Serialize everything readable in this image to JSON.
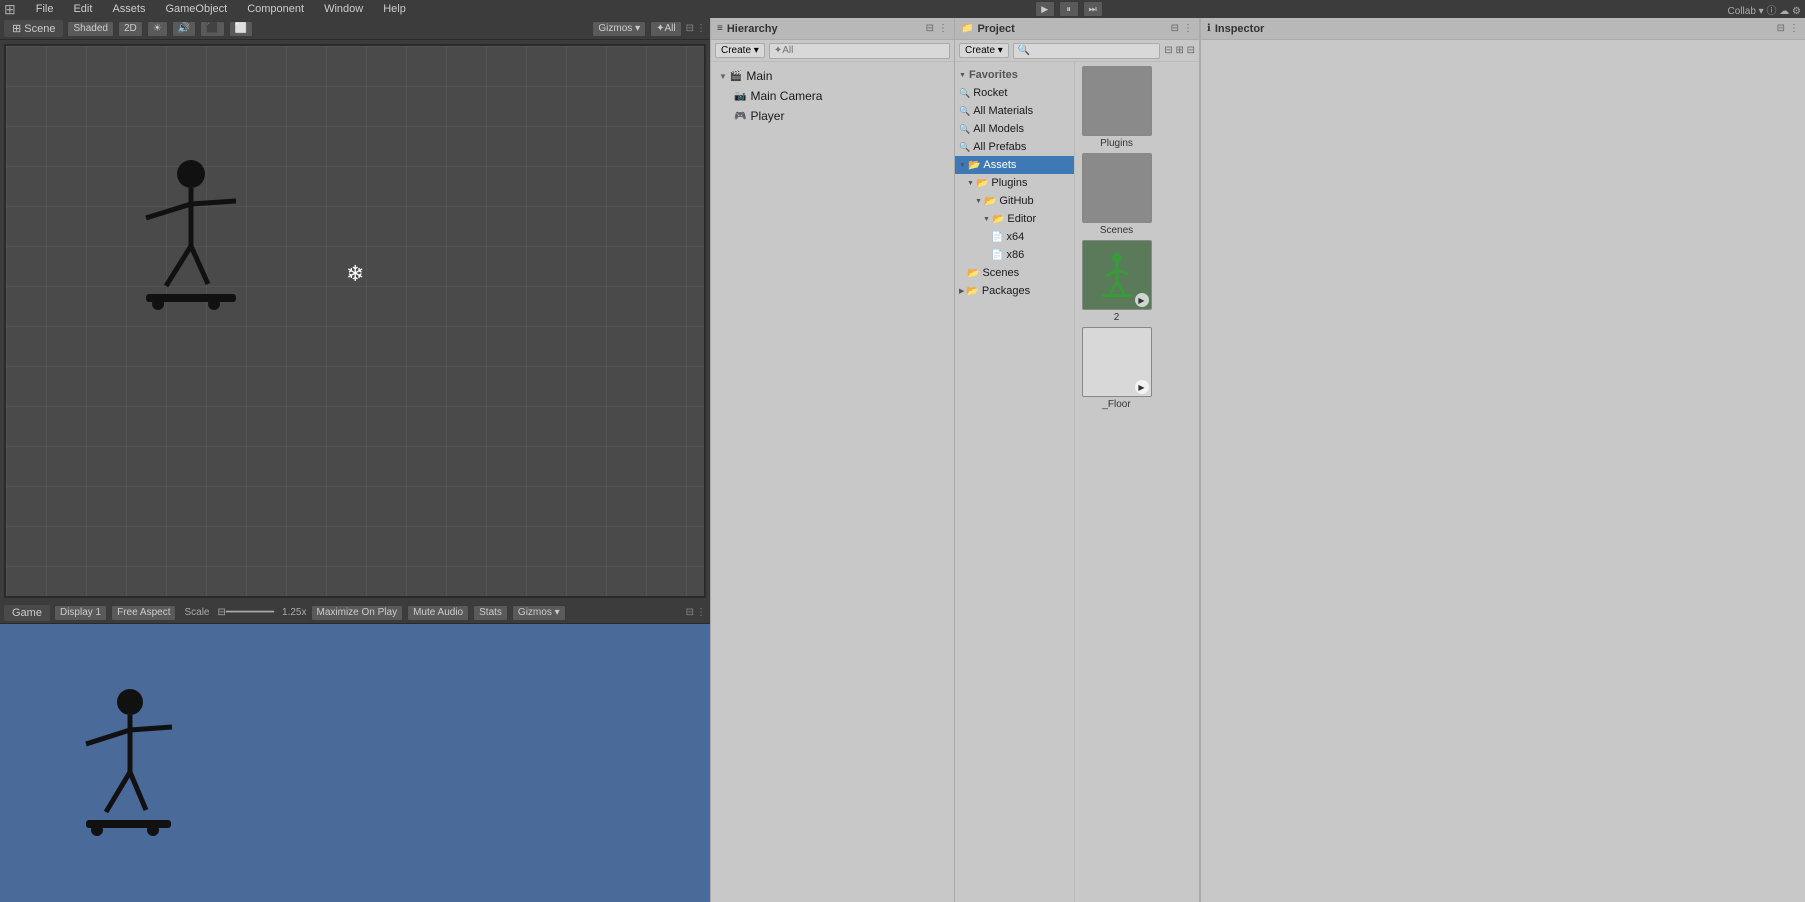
{
  "menubar": {
    "items": [
      "File",
      "Edit",
      "Assets",
      "GameObject",
      "Component",
      "Window",
      "Help"
    ]
  },
  "play_controls": {
    "play_label": "▶",
    "pause_label": "⏸",
    "step_label": "⏭"
  },
  "scene_panel": {
    "tab_label": "Scene",
    "shading_mode": "Shaded",
    "toolbar_2d": "2D",
    "gizmos_label": "Gizmos ▾",
    "filter_label": "✦All"
  },
  "game_panel": {
    "tab_label": "Game",
    "display_label": "Display 1",
    "aspect_label": "Free Aspect",
    "scale_label": "Scale",
    "scale_value": "1.25x",
    "maximize_label": "Maximize On Play",
    "mute_label": "Mute Audio",
    "stats_label": "Stats",
    "gizmos_label": "Gizmos ▾"
  },
  "hierarchy_panel": {
    "title": "Hierarchy",
    "create_label": "Create ▾",
    "search_placeholder": "✦All",
    "items": [
      {
        "id": "main",
        "label": "Main",
        "level": 0,
        "arrow": "▼",
        "icon": "🎬",
        "type": "scene"
      },
      {
        "id": "main-camera",
        "label": "Main Camera",
        "level": 1,
        "arrow": "",
        "icon": "📷",
        "type": "camera"
      },
      {
        "id": "player",
        "label": "Player",
        "level": 1,
        "arrow": "",
        "icon": "🎮",
        "type": "object"
      }
    ]
  },
  "project_panel": {
    "title": "Project",
    "create_label": "Create ▾",
    "search_placeholder": "🔍",
    "favorites": {
      "label": "Favorites",
      "items": [
        {
          "id": "rocket",
          "label": "Rocket",
          "icon": "🔍"
        },
        {
          "id": "all-materials",
          "label": "All Materials",
          "icon": "🔍"
        },
        {
          "id": "all-models",
          "label": "All Models",
          "icon": "🔍"
        },
        {
          "id": "all-prefabs",
          "label": "All Prefabs",
          "icon": "🔍"
        }
      ]
    },
    "assets": {
      "label": "Assets",
      "tree": [
        {
          "id": "assets-root",
          "label": "Assets",
          "level": 0,
          "arrow": "▼",
          "expanded": true
        },
        {
          "id": "plugins",
          "label": "Plugins",
          "level": 1,
          "arrow": "▼",
          "expanded": true
        },
        {
          "id": "github",
          "label": "GitHub",
          "level": 2,
          "arrow": "▼",
          "expanded": true
        },
        {
          "id": "editor",
          "label": "Editor",
          "level": 3,
          "arrow": "▼",
          "expanded": true
        },
        {
          "id": "x64",
          "label": "x64",
          "level": 4,
          "arrow": "",
          "expanded": false
        },
        {
          "id": "x86",
          "label": "x86",
          "level": 4,
          "arrow": "",
          "expanded": false
        },
        {
          "id": "scenes",
          "label": "Scenes",
          "level": 1,
          "arrow": "",
          "expanded": false
        },
        {
          "id": "packages",
          "label": "Packages",
          "level": 0,
          "arrow": "▶",
          "expanded": false
        }
      ]
    },
    "asset_items": [
      {
        "id": "plugins-folder",
        "label": "Plugins",
        "type": "folder"
      },
      {
        "id": "scenes-folder",
        "label": "Scenes",
        "type": "folder"
      },
      {
        "id": "sprite-2",
        "label": "2",
        "type": "sprite"
      },
      {
        "id": "floor",
        "label": "_Floor",
        "type": "sprite-white"
      }
    ]
  },
  "inspector_panel": {
    "title": "Inspector"
  }
}
